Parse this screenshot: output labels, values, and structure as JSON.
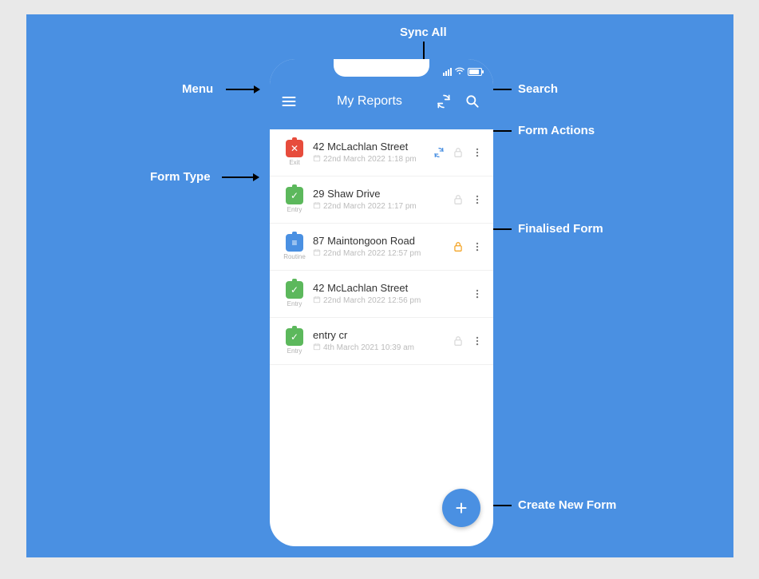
{
  "header": {
    "title": "My Reports"
  },
  "status": {
    "signal": "signal-icon",
    "wifi": "wifi-icon",
    "battery": "battery-icon"
  },
  "rows": [
    {
      "title": "42 McLachlan Street",
      "date": "22nd March 2022 1:18 pm",
      "type": "Exit",
      "typeClass": "exit",
      "glyph": "✕",
      "sync": true,
      "lock": "dim"
    },
    {
      "title": "29 Shaw Drive",
      "date": "22nd March 2022 1:17 pm",
      "type": "Entry",
      "typeClass": "entry",
      "glyph": "✓",
      "sync": false,
      "lock": "dim"
    },
    {
      "title": "87 Maintongoon Road",
      "date": "22nd March 2022 12:57 pm",
      "type": "Routine",
      "typeClass": "routine",
      "glyph": "≡",
      "sync": false,
      "lock": "active"
    },
    {
      "title": "42 McLachlan Street",
      "date": "22nd March 2022 12:56 pm",
      "type": "Entry",
      "typeClass": "entry",
      "glyph": "✓",
      "sync": false,
      "lock": "none"
    },
    {
      "title": "entry cr",
      "date": "4th March 2021 10:39 am",
      "type": "Entry",
      "typeClass": "entry",
      "glyph": "✓",
      "sync": false,
      "lock": "dim"
    }
  ],
  "fab": {
    "glyph": "+"
  },
  "callouts": {
    "syncAll": "Sync All",
    "menu": "Menu",
    "search": "Search",
    "formActions": "Form Actions",
    "formType": "Form Type",
    "finalisedForm": "Finalised Form",
    "createNewForm": "Create New Form"
  },
  "colors": {
    "canvas": "#4a90e2",
    "highlight": "#3b4a8f",
    "exit": "#e74c3c",
    "entry": "#5cb85c",
    "routine": "#4a90e2",
    "lockActive": "#f39c12"
  }
}
